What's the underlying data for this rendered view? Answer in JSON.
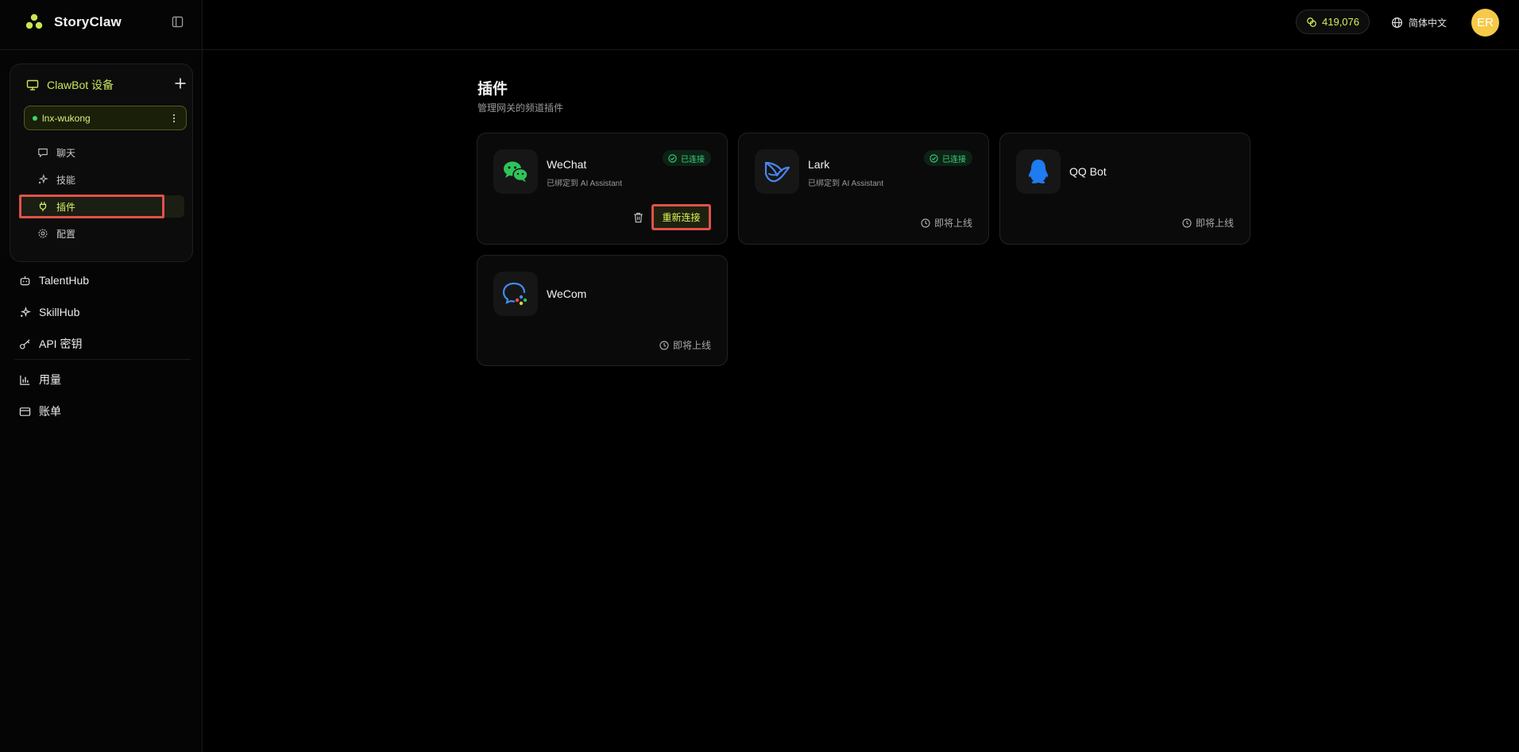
{
  "app": {
    "name": "StoryClaw"
  },
  "sidebar": {
    "device_section": {
      "title": "ClawBot 设备",
      "selected_device": "lnx-wukong",
      "items": [
        {
          "label": "聊天",
          "icon": "chat-icon"
        },
        {
          "label": "技能",
          "icon": "sparkle-icon"
        },
        {
          "label": "插件",
          "icon": "plug-icon",
          "active": true
        },
        {
          "label": "配置",
          "icon": "settings-icon"
        }
      ]
    },
    "nav": [
      {
        "label": "TalentHub",
        "icon": "robot-icon"
      },
      {
        "label": "SkillHub",
        "icon": "sparkle-icon"
      },
      {
        "label": "API 密钥",
        "icon": "key-icon"
      },
      {
        "label": "用量",
        "icon": "bar-chart-icon"
      },
      {
        "label": "账单",
        "icon": "credit-card-icon"
      }
    ]
  },
  "header": {
    "credits": "419,076",
    "language": "简体中文",
    "avatar_initials": "ER"
  },
  "main": {
    "title": "插件",
    "subtitle": "管理网关的频道插件",
    "plugins": [
      {
        "name": "WeChat",
        "bound_text": "已绑定到 AI Assistant",
        "status": "已连接",
        "action": "重新连接",
        "icon": "wechat-icon"
      },
      {
        "name": "Lark",
        "bound_text": "已绑定到 AI Assistant",
        "status": "已连接",
        "footer": "即将上线",
        "icon": "lark-icon"
      },
      {
        "name": "QQ Bot",
        "footer": "即将上线",
        "icon": "qq-icon"
      },
      {
        "name": "WeCom",
        "footer": "即将上线",
        "icon": "wecom-icon"
      }
    ]
  },
  "colors": {
    "accent": "#d6ef5a",
    "success": "#3ed27a",
    "highlight": "#e0524a",
    "avatar": "#f7c948",
    "background": "#000000"
  }
}
